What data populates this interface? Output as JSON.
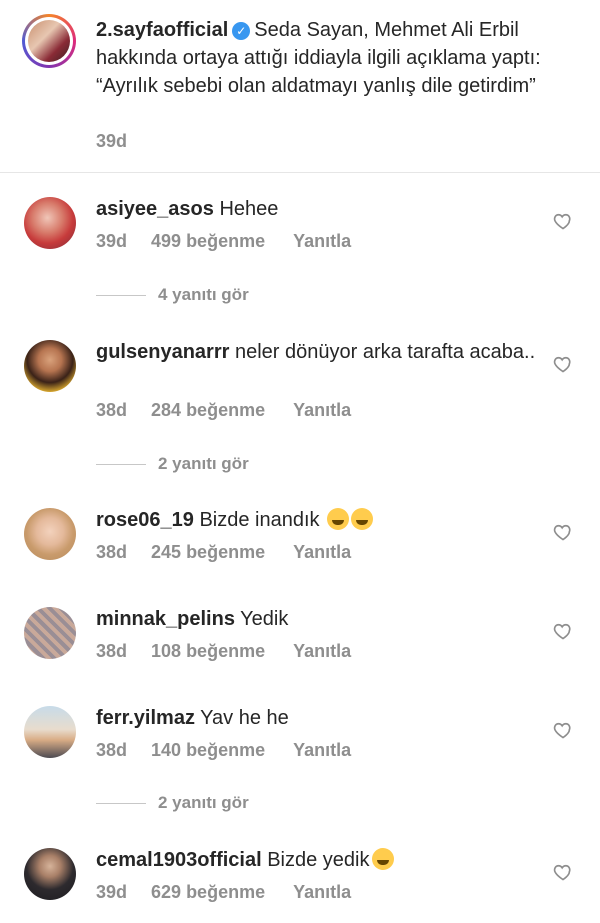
{
  "post": {
    "username": "2.sayfaofficial",
    "caption": "Seda Sayan, Mehmet Ali Erbil hakkında ortaya attığı iddiayla ilgili açıklama yaptı: “Ayrılık sebebi olan aldatmayı yanlış dile getirdim”",
    "time": "39d",
    "verified_mark": "✓"
  },
  "comments": [
    {
      "username": "asiyee_asos",
      "text": "Hehee",
      "time": "39d",
      "likes": "499 beğenme",
      "reply": "Yanıtla",
      "view_replies": "4 yanıtı gör"
    },
    {
      "username": "gulsenyanarrr",
      "text": "neler dönüyor arka tarafta acaba..",
      "time": "38d",
      "likes": "284 beğenme",
      "reply": "Yanıtla",
      "view_replies": "2 yanıtı gör"
    },
    {
      "username": "rose06_19",
      "text": "Bizde inandık",
      "time": "38d",
      "likes": "245 beğenme",
      "reply": "Yanıtla"
    },
    {
      "username": "minnak_pelins",
      "text": "Yedik",
      "time": "38d",
      "likes": "108 beğenme",
      "reply": "Yanıtla"
    },
    {
      "username": "ferr.yilmaz",
      "text": "Yav he he",
      "time": "38d",
      "likes": "140 beğenme",
      "reply": "Yanıtla",
      "view_replies": "2 yanıtı gör"
    },
    {
      "username": "cemal1903official",
      "text": "Bizde yedik",
      "time": "39d",
      "likes": "629 beğenme",
      "reply": "Yanıtla"
    }
  ],
  "colors": {
    "text": "#262626",
    "muted": "#8e8e8e",
    "verified": "#3897f0",
    "divider": "#e6e6e6"
  }
}
